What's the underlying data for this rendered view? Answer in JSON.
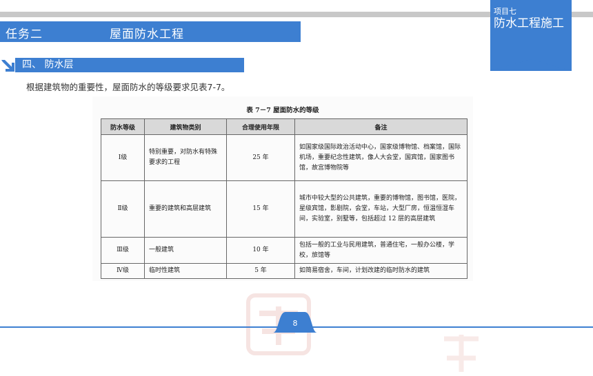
{
  "header": {
    "task": "任务二",
    "topic": "屋面防水工程"
  },
  "badge": {
    "label": "项目七",
    "name": "防水工程施工"
  },
  "section": {
    "title": "四、 防水层"
  },
  "description": "根据建筑物的重要性，屋面防水的等级要求见表7-7。",
  "table": {
    "caption": "表 7－7    屋面防水的等级",
    "headers": [
      "防水等级",
      "建筑物类别",
      "合理使用年限",
      "备注"
    ],
    "rows": [
      [
        "Ⅰ级",
        "特别重要，对防水有特殊要求的工程",
        "25 年",
        "如国家级国际政治活动中心，国家级博物馆、档案馆，国际机场，重要纪念性建筑，像人大会堂，国宾馆，国家图书馆，故宫博物院等"
      ],
      [
        "Ⅱ级",
        "重要的建筑和高层建筑",
        "15 年",
        "城市中较大型的公共建筑，重要的博物馆，图书馆，医院，星级宾馆，影剧院，会堂，车站，大型厂房，恒温恒湿车间，实验室，别墅等，包括超过 12 层的高层建筑"
      ],
      [
        "Ⅲ级",
        "一般建筑",
        "10 年",
        "包括一般的工业与民用建筑，普通住宅，一般办公楼，学校，旅馆等"
      ],
      [
        "Ⅳ级",
        "临时性建筑",
        "5 年",
        "如简易宿舍，车间，计划改建的临时防水的建筑"
      ]
    ]
  },
  "footer": {
    "page": "8"
  },
  "colors": {
    "accent": "#3d7fd1",
    "top_bar": "#c8c8c8",
    "table_header": "#d9d9d9"
  }
}
